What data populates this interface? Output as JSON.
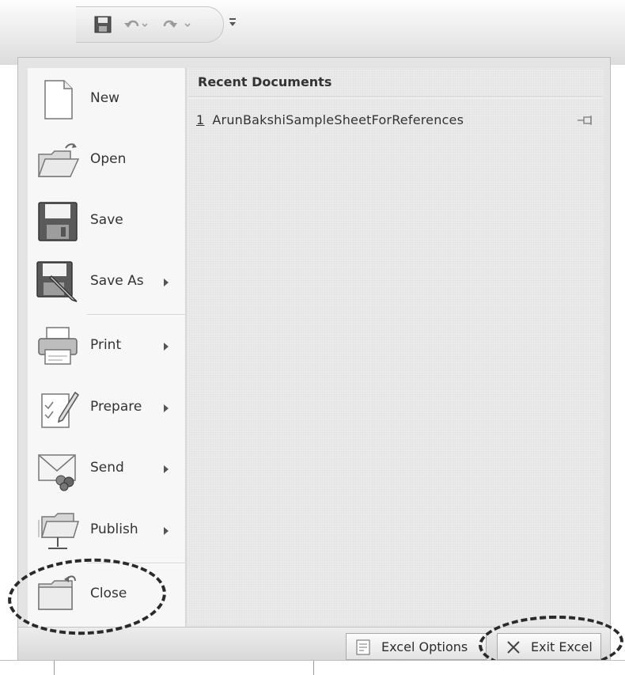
{
  "quick_access": {
    "items": [
      "save-icon",
      "undo-icon",
      "redo-icon"
    ],
    "customize_icon": "customize-dropdown-icon"
  },
  "menu": {
    "items": [
      {
        "label": "New",
        "icon": "new-document-icon",
        "submenu": false
      },
      {
        "label": "Open",
        "icon": "open-folder-icon",
        "submenu": false
      },
      {
        "label": "Save",
        "icon": "save-icon",
        "submenu": false
      },
      {
        "label": "Save As",
        "icon": "save-as-icon",
        "submenu": true
      },
      {
        "label": "Print",
        "icon": "printer-icon",
        "submenu": true
      },
      {
        "label": "Prepare",
        "icon": "prepare-document-icon",
        "submenu": true
      },
      {
        "label": "Send",
        "icon": "send-icon",
        "submenu": true
      },
      {
        "label": "Publish",
        "icon": "publish-icon",
        "submenu": true
      },
      {
        "label": "Close",
        "icon": "close-folder-icon",
        "submenu": false
      }
    ]
  },
  "recent": {
    "title": "Recent Documents",
    "items": [
      {
        "num": "1",
        "name": "ArunBakshiSampleSheetForReferences"
      }
    ]
  },
  "footer": {
    "options_label": "Excel Options",
    "exit_label": "Exit Excel"
  },
  "colors": {
    "menu_background": "#e4e4e4",
    "left_pane": "#f7f7f7",
    "annotation_circle": "#2a2a2a"
  }
}
